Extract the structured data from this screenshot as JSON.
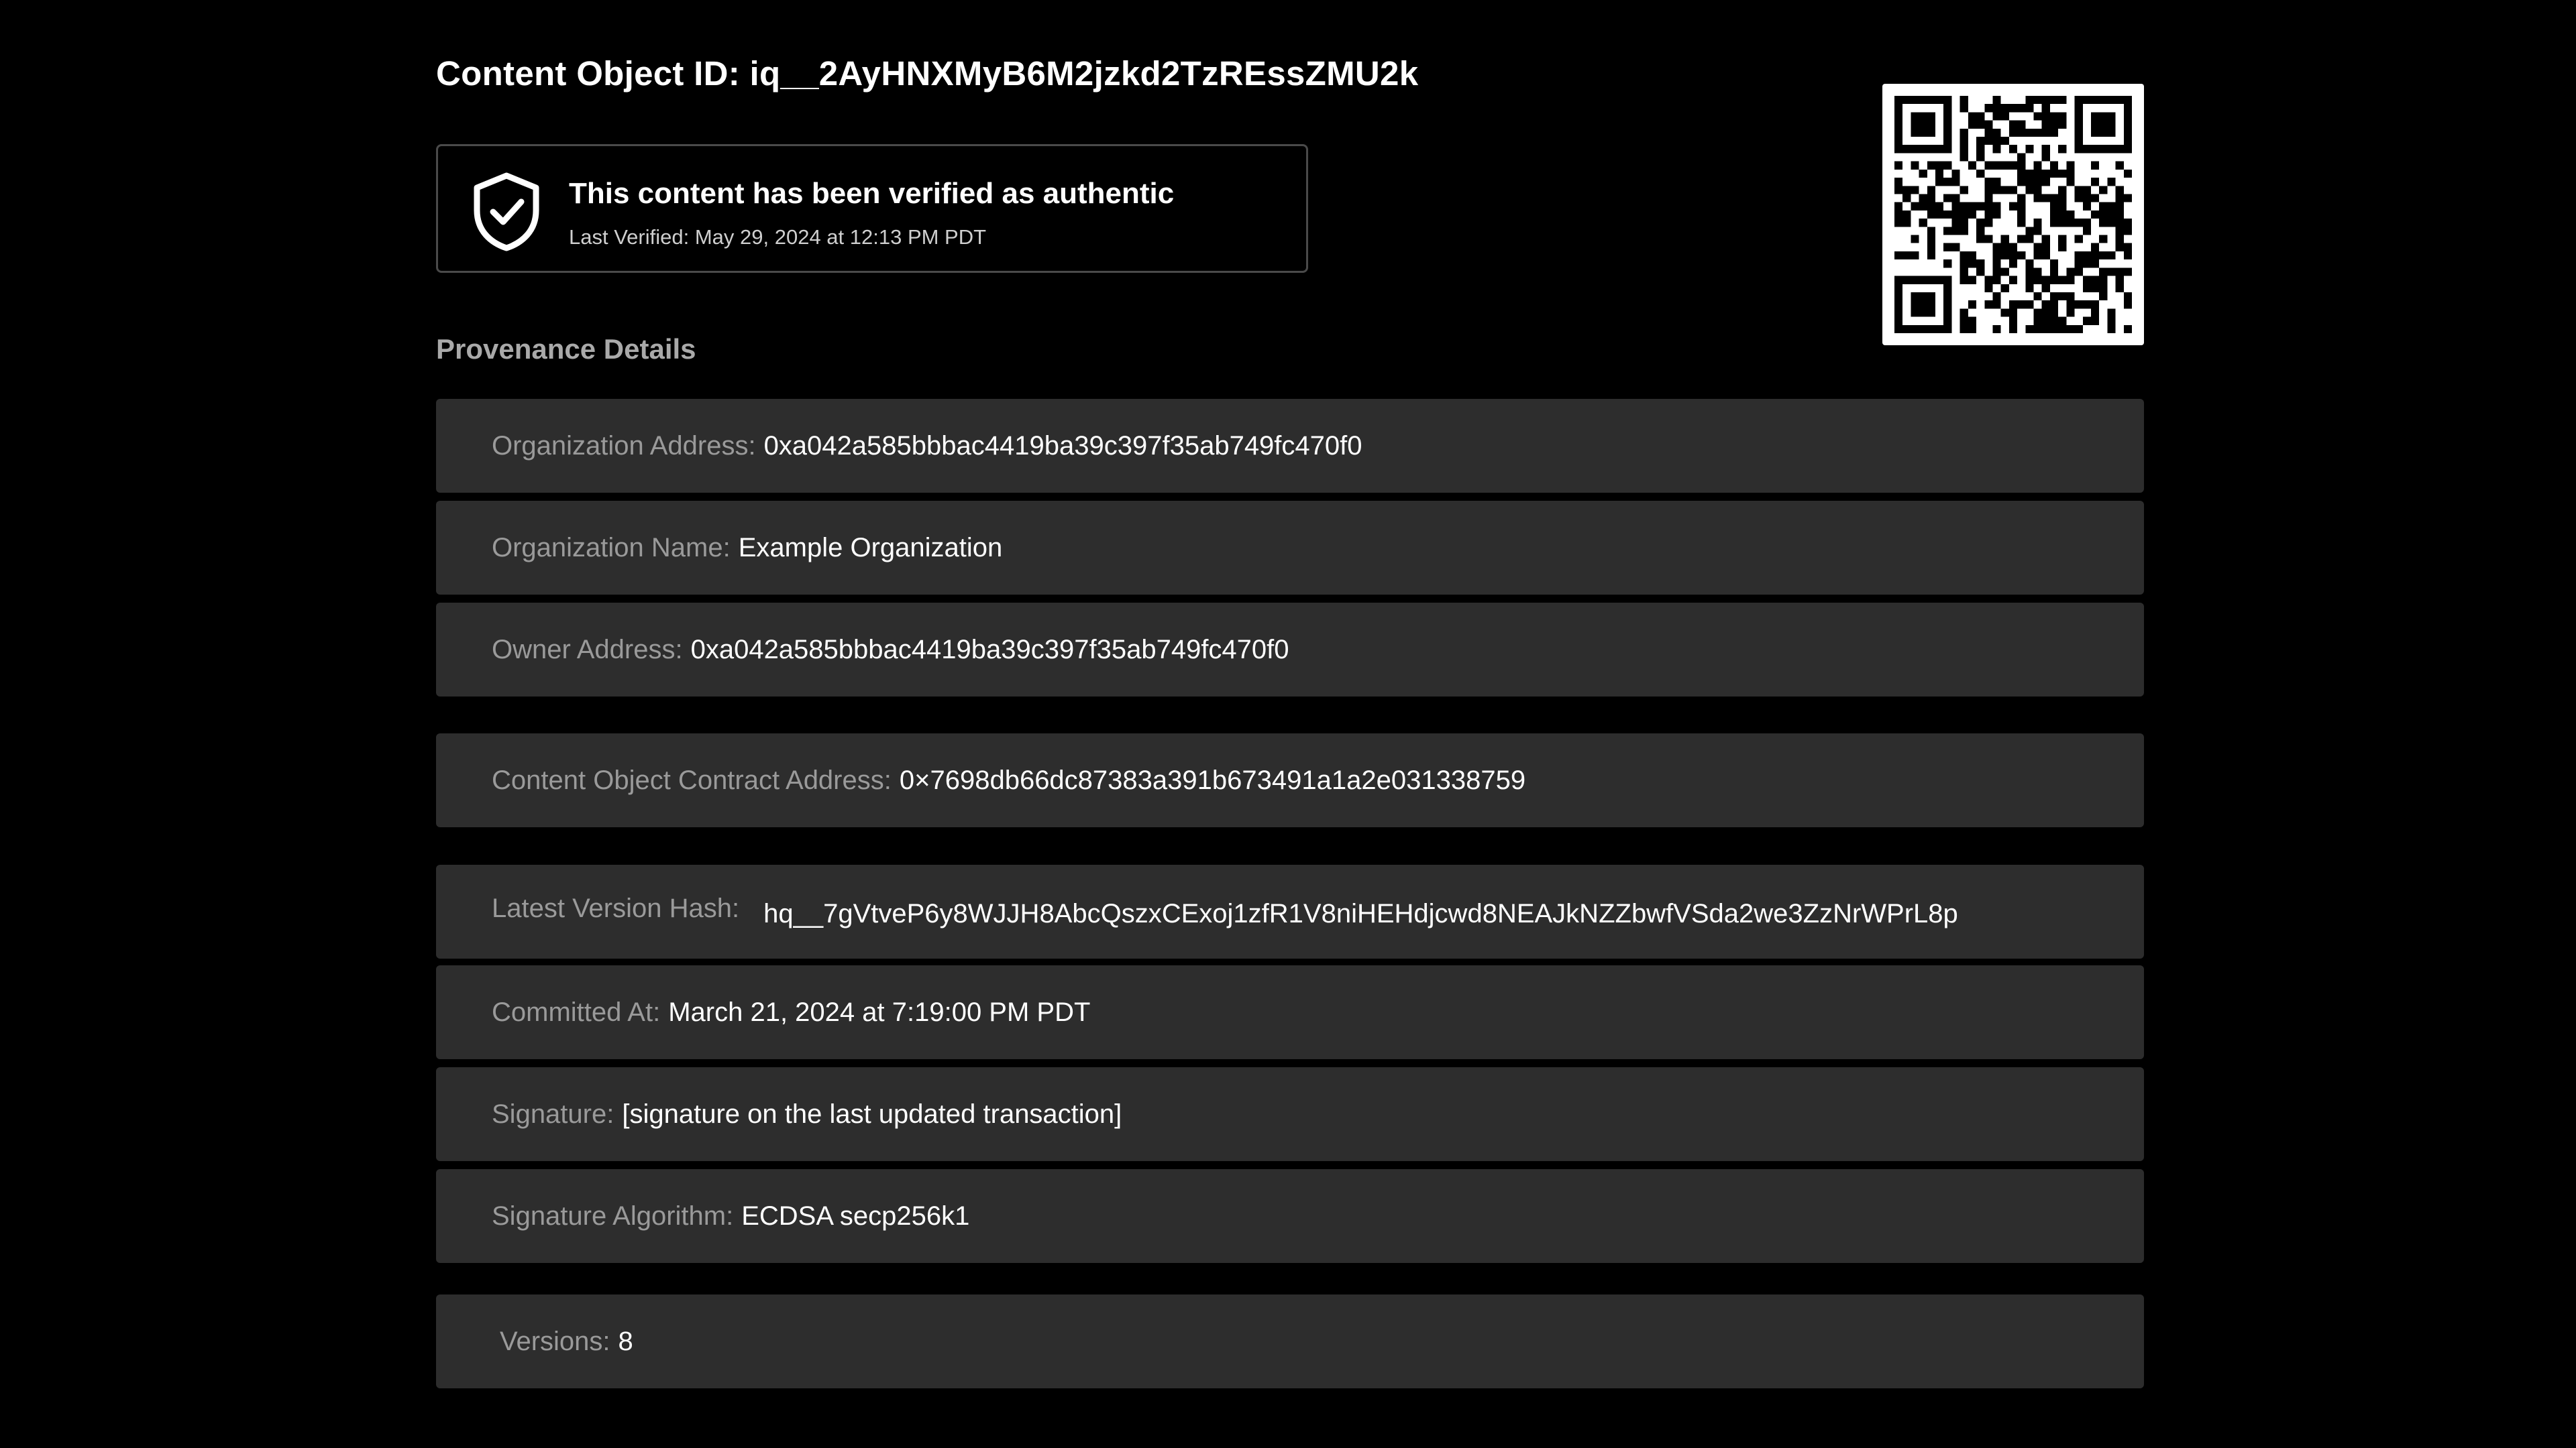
{
  "header": {
    "title": "Content Object ID: iq__2AyHNXMyB6M2jzkd2TzREssZMU2k"
  },
  "verification": {
    "icon": "shield-check-icon",
    "status": "This content has been verified as authentic",
    "last_verified": "Last Verified: May 29, 2024 at 12:13 PM PDT"
  },
  "qr_code": {
    "icon": "qr-code"
  },
  "provenance": {
    "heading": "Provenance Details",
    "rows": [
      {
        "label": "Organization Address:",
        "value": "0xa042a585bbbac4419ba39c397f35ab749fc470f0"
      },
      {
        "label": "Organization Name:",
        "value": "Example Organization"
      },
      {
        "label": "Owner Address:",
        "value": "0xa042a585bbbac4419ba39c397f35ab749fc470f0"
      },
      {
        "label": "Content Object Contract Address:",
        "value": "0×7698db66dc87383a391b673491a1a2e031338759"
      },
      {
        "label": "Latest Version Hash:",
        "value": "hq__7gVtveP6y8WJJH8AbcQszxCExoj1zfR1V8niHEHdjcwd8NEAJkNZZbwfVSda2we3ZzNrWPrL8p"
      },
      {
        "label": "Committed At:",
        "value": "March 21, 2024 at 7:19:00 PM PDT"
      },
      {
        "label": "Signature:",
        "value": "[signature on the last updated transaction]"
      },
      {
        "label": "Signature Algorithm:",
        "value": "ECDSA secp256k1"
      },
      {
        "label": "Versions:",
        "value": "8"
      }
    ]
  },
  "colors": {
    "background": "#000000",
    "row_background": "#2d2d2d",
    "label_text": "#9a9a9a",
    "value_text": "#ffffff"
  }
}
